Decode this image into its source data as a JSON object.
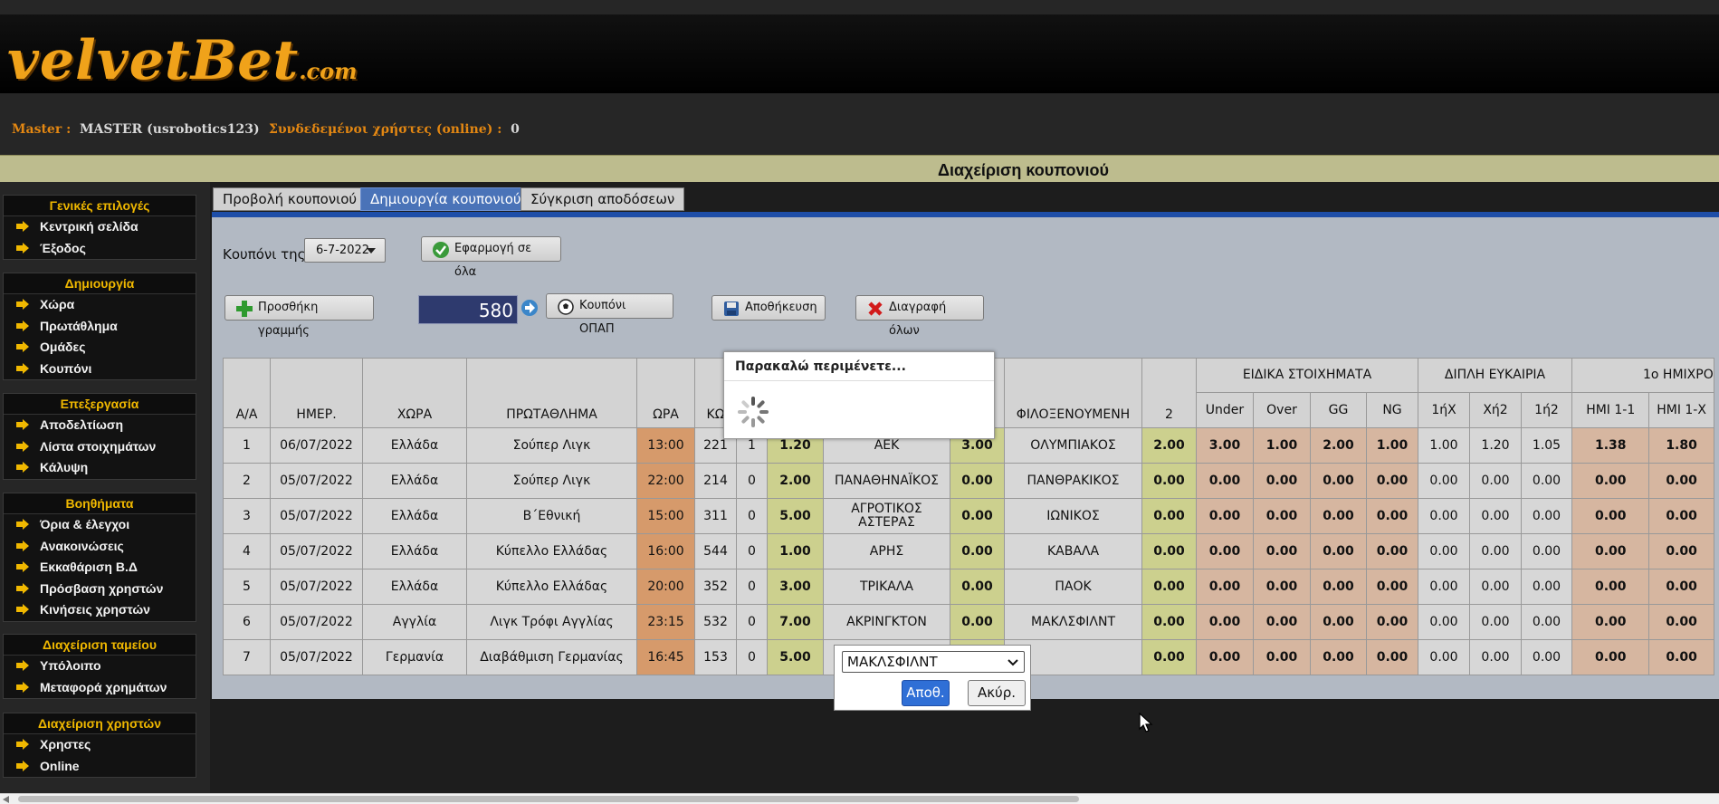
{
  "logo": {
    "main": "velvetBet",
    "suffix": ".com"
  },
  "info": {
    "master_label": "Master :",
    "master_value": "MASTER (usrobotics123)",
    "online_label": "Συνδεδεμένοι χρήστες (online) :",
    "online_value": "0"
  },
  "page_title": "Διαχείριση κουπονιού",
  "sidebar": [
    {
      "title": "Γενικές επιλογές",
      "items": [
        "Κεντρική σελίδα",
        "Έξοδος"
      ]
    },
    {
      "title": "Δημιουργία",
      "items": [
        "Χώρα",
        "Πρωτάθλημα",
        "Ομάδες",
        "Κουπόνι"
      ]
    },
    {
      "title": "Επεξεργασία",
      "items": [
        "Αποδελτίωση",
        "Λίστα στοιχημάτων",
        "Κάλυψη"
      ]
    },
    {
      "title": "Βοηθήματα",
      "items": [
        "Όρια & έλεγχοι",
        "Ανακοινώσεις",
        "Εκκαθάριση Β.Δ",
        "Πρόσβαση χρηστών",
        "Κινήσεις χρηστών"
      ]
    },
    {
      "title": "Διαχείριση ταμείου",
      "items": [
        "Υπόλοιπο",
        "Μεταφορά χρημάτων"
      ]
    },
    {
      "title": "Διαχείριση χρηστών",
      "items": [
        "Χρηστες",
        "Online"
      ]
    }
  ],
  "tabs": [
    "Προβολή κουπονιού",
    "Δημιουργία κουπονιού",
    "Σύγκριση αποδόσεων"
  ],
  "toolbar": {
    "coupon_label": "Κουπόνι της",
    "coupon_date": "6-7-2022",
    "apply_all": "Εφαρμογή σε όλα",
    "add_line": "Προσθήκη γραμμής",
    "number": "580",
    "opap": "Κουπόνι ΟΠΑΠ",
    "save": "Αποθήκευση",
    "delete_all": "Διαγραφή όλων"
  },
  "table": {
    "groups": {
      "special": "ΕΙΔΙΚΑ ΣΤΟΙΧΗΜΑΤΑ",
      "double": "ΔΙΠΛΗ ΕΥΚΑΙΡΙΑ",
      "half": "1ο ΗΜΙΧΡΟ"
    },
    "columns": [
      "Α/Α",
      "ΗΜΕΡ.",
      "ΧΩΡΑ",
      "ΠΡΩΤΑΘΛΗΜΑ",
      "ΩΡΑ",
      "ΚΩ",
      "",
      "",
      "",
      "",
      "ΦΙΛΟΞΕΝΟΥΜΕΝΗ",
      "2",
      "Under",
      "Over",
      "GG",
      "NG",
      "1ήΧ",
      "Χή2",
      "1ή2",
      "ΗΜΙ 1-1",
      "ΗΜΙ 1-Χ"
    ],
    "rows": [
      [
        "1",
        "06/07/2022",
        "Ελλάδα",
        "Σούπερ Λιγκ",
        "13:00",
        "221",
        "1",
        "1.20",
        "ΑΕΚ",
        "3.00",
        "ΟΛΥΜΠΙΑΚΟΣ",
        "2.00",
        "3.00",
        "1.00",
        "2.00",
        "1.00",
        "1.00",
        "1.20",
        "1.05",
        "1.38",
        "1.80"
      ],
      [
        "2",
        "05/07/2022",
        "Ελλάδα",
        "Σούπερ Λιγκ",
        "22:00",
        "214",
        "0",
        "2.00",
        "ΠΑΝΑΘΗΝΑΪΚΟΣ",
        "0.00",
        "ΠΑΝΘΡΑΚΙΚΟΣ",
        "0.00",
        "0.00",
        "0.00",
        "0.00",
        "0.00",
        "0.00",
        "0.00",
        "0.00",
        "0.00",
        "0.00"
      ],
      [
        "3",
        "05/07/2022",
        "Ελλάδα",
        "Β΄Εθνική",
        "15:00",
        "311",
        "0",
        "5.00",
        "ΑΓΡΟΤΙΚΟΣ ΑΣΤΕΡΑΣ",
        "0.00",
        "ΙΩΝΙΚΟΣ",
        "0.00",
        "0.00",
        "0.00",
        "0.00",
        "0.00",
        "0.00",
        "0.00",
        "0.00",
        "0.00",
        "0.00"
      ],
      [
        "4",
        "05/07/2022",
        "Ελλάδα",
        "Κύπελλο Ελλάδας",
        "16:00",
        "544",
        "0",
        "1.00",
        "ΑΡΗΣ",
        "0.00",
        "ΚΑΒΑΛΑ",
        "0.00",
        "0.00",
        "0.00",
        "0.00",
        "0.00",
        "0.00",
        "0.00",
        "0.00",
        "0.00",
        "0.00"
      ],
      [
        "5",
        "05/07/2022",
        "Ελλάδα",
        "Κύπελλο Ελλάδας",
        "20:00",
        "352",
        "0",
        "3.00",
        "ΤΡΙΚΑΛΑ",
        "0.00",
        "ΠΑΟΚ",
        "0.00",
        "0.00",
        "0.00",
        "0.00",
        "0.00",
        "0.00",
        "0.00",
        "0.00",
        "0.00",
        "0.00"
      ],
      [
        "6",
        "05/07/2022",
        "Αγγλία",
        "Λιγκ Τρόφι Αγγλίας",
        "23:15",
        "532",
        "0",
        "7.00",
        "ΑΚΡΙΝΓΚΤΟΝ",
        "0.00",
        "ΜΑΚΛΣΦΙΛΝΤ",
        "0.00",
        "0.00",
        "0.00",
        "0.00",
        "0.00",
        "0.00",
        "0.00",
        "0.00",
        "0.00",
        "0.00"
      ],
      [
        "7",
        "05/07/2022",
        "Γερμανία",
        "Διαβάθμιση Γερμανίας",
        "16:45",
        "153",
        "0",
        "5.00",
        "",
        "",
        "",
        "0.00",
        "0.00",
        "0.00",
        "0.00",
        "0.00",
        "0.00",
        "0.00",
        "0.00",
        "0.00",
        "0.00"
      ]
    ]
  },
  "loading": {
    "title": "Παρακαλώ περιμένετε..."
  },
  "select_popup": {
    "value": "ΜΑΚΛΣΦΙΛΝΤ",
    "ok": "Αποθ.",
    "cancel": "Ακύρ."
  },
  "colors": {
    "accent": "#f0a21a",
    "tab_active": "#4a73b8",
    "odds_green": "#ccd08e",
    "odds_pink": "#d6b6a0",
    "time_orange": "#d69a6b"
  }
}
